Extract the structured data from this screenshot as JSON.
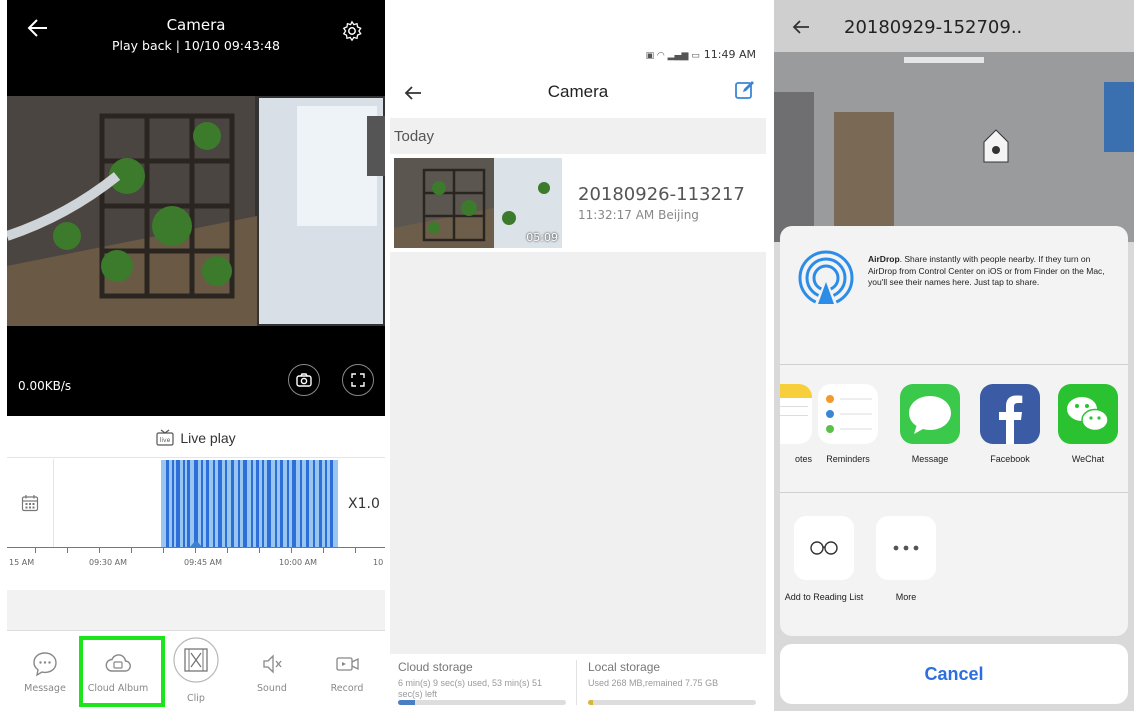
{
  "panel1": {
    "title": "Camera",
    "subtitle": "Play back | 10/10 09:43:48",
    "speed": "0.00KB/s",
    "live_play_label": "Live play",
    "zoom_label": "X1.0",
    "timeline_labels": [
      "15 AM",
      "09:30 AM",
      "09:45 AM",
      "10:00 AM",
      "10"
    ],
    "bottom_items": [
      {
        "label": "Message",
        "icon": "chat-bubble-icon"
      },
      {
        "label": "Cloud Album",
        "icon": "cloud-album-icon"
      },
      {
        "label": "Clip",
        "icon": "clip-film-icon"
      },
      {
        "label": "Sound",
        "icon": "speaker-muted-icon"
      },
      {
        "label": "Record",
        "icon": "video-record-icon"
      }
    ],
    "highlight_color": "#1ce51c"
  },
  "panel2": {
    "status_bar": "11:49 AM",
    "title": "Camera",
    "section_today": "Today",
    "recording": {
      "name": "20180926-113217",
      "time": "11:32:17 AM Beijing",
      "duration": "05:09"
    },
    "cloud_storage": {
      "label": "Cloud storage",
      "detail": "6 min(s) 9 sec(s) used, 53 min(s) 51 sec(s) left",
      "used_fraction": 0.1
    },
    "local_storage": {
      "label": "Local storage",
      "detail": "Used 268 MB,remained 7.75 GB",
      "used_fraction": 0.03
    }
  },
  "panel3": {
    "title": "20180929-152709..",
    "airdrop_title": "AirDrop",
    "airdrop_text": ". Share instantly with people nearby. If they turn on AirDrop from Control Center on iOS or from Finder on the Mac, you'll see their names here. Just tap to share.",
    "apps": [
      {
        "label": "otes",
        "icon": "notes-icon"
      },
      {
        "label": "Reminders",
        "icon": "reminders-icon"
      },
      {
        "label": "Message",
        "icon": "message-icon"
      },
      {
        "label": "Facebook",
        "icon": "facebook-icon"
      },
      {
        "label": "WeChat",
        "icon": "wechat-icon"
      }
    ],
    "actions": [
      {
        "label": "Add to Reading List",
        "icon": "glasses-icon"
      },
      {
        "label": "More",
        "icon": "more-dots-icon"
      }
    ],
    "cancel_label": "Cancel",
    "accent_color": "#2c6ee0"
  }
}
